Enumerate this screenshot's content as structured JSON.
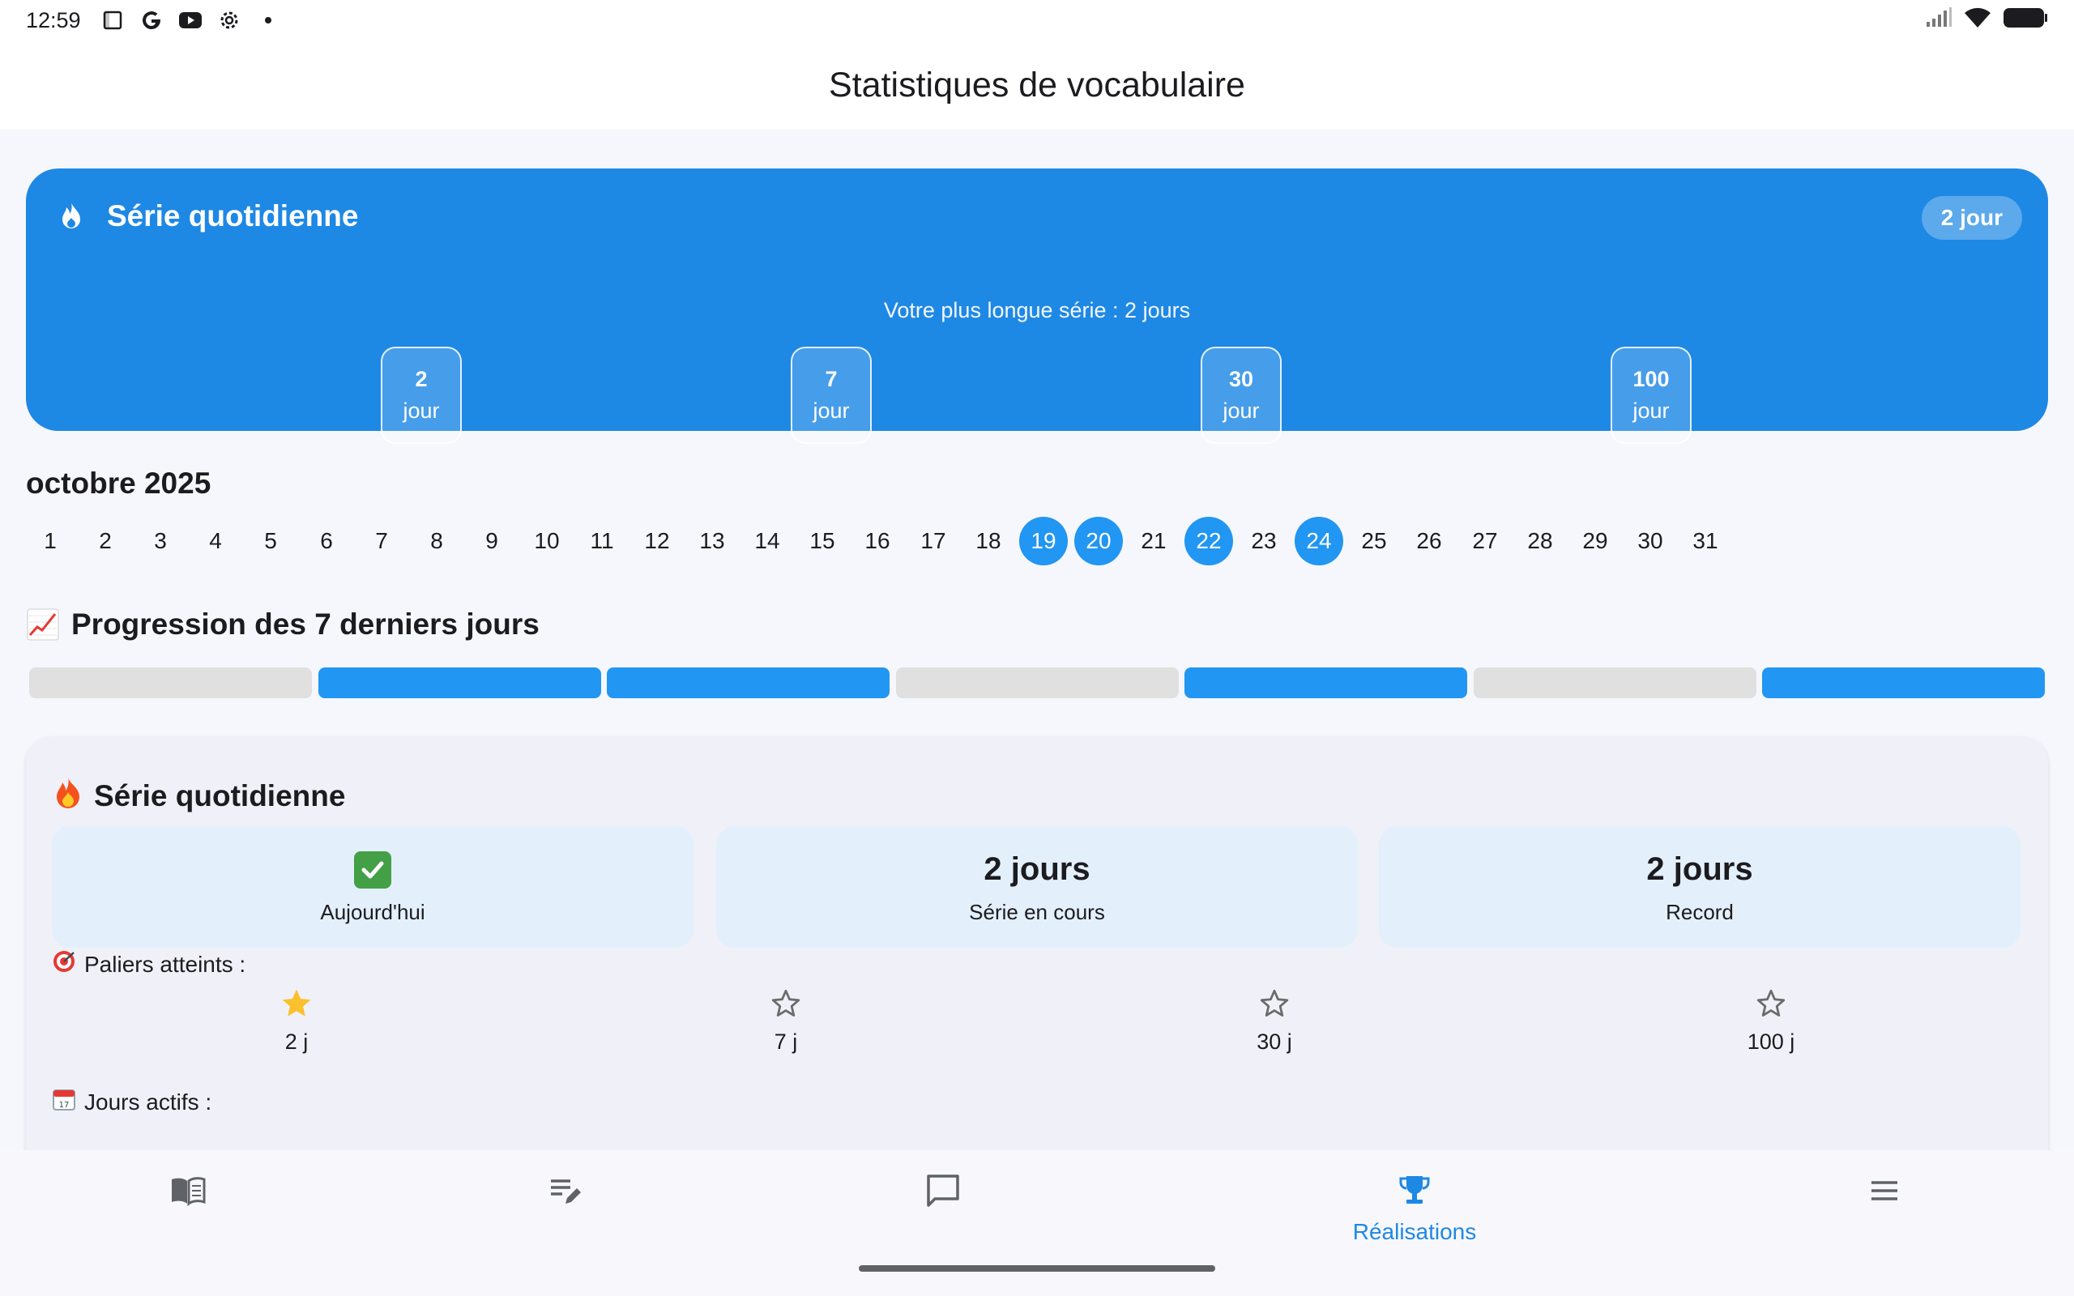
{
  "status_bar": {
    "time": "12:59"
  },
  "app_bar": {
    "title": "Statistiques de vocabulaire"
  },
  "streak_banner": {
    "title": "Série quotidienne",
    "badge": "2 jour",
    "longest": "Votre plus longue série : 2 jours",
    "milestones": [
      {
        "value": "2",
        "unit": "jour"
      },
      {
        "value": "7",
        "unit": "jour"
      },
      {
        "value": "30",
        "unit": "jour"
      },
      {
        "value": "100",
        "unit": "jour"
      }
    ]
  },
  "calendar": {
    "month": "octobre 2025",
    "days": [
      "1",
      "2",
      "3",
      "4",
      "5",
      "6",
      "7",
      "8",
      "9",
      "10",
      "11",
      "12",
      "13",
      "14",
      "15",
      "16",
      "17",
      "18",
      "19",
      "20",
      "21",
      "22",
      "23",
      "24",
      "25",
      "26",
      "27",
      "28",
      "29",
      "30",
      "31"
    ],
    "active_days": [
      "19",
      "20",
      "22",
      "24"
    ]
  },
  "progress": {
    "title": "Progression des 7 derniers jours",
    "days_done": [
      false,
      true,
      true,
      false,
      true,
      false,
      true
    ]
  },
  "streak_card": {
    "title": "Série quotidienne",
    "stats": [
      {
        "value": "",
        "label": "Aujourd'hui"
      },
      {
        "value": "2 jours",
        "label": "Série en cours"
      },
      {
        "value": "2 jours",
        "label": "Record"
      }
    ],
    "paliers_title": "Paliers atteints :",
    "paliers": [
      {
        "label": "2 j",
        "reached": true
      },
      {
        "label": "7 j",
        "reached": false
      },
      {
        "label": "30 j",
        "reached": false
      },
      {
        "label": "100 j",
        "reached": false
      }
    ],
    "jours_actifs_title": "Jours actifs :"
  },
  "bottom_nav": {
    "items": [
      {
        "icon": "book-icon",
        "label": ""
      },
      {
        "icon": "edit-list-icon",
        "label": ""
      },
      {
        "icon": "chat-icon",
        "label": ""
      },
      {
        "icon": "trophy-icon",
        "label": "Réalisations"
      },
      {
        "icon": "menu-icon",
        "label": ""
      }
    ],
    "active_index": 3
  },
  "colors": {
    "primary": "#1e88e5",
    "active_day": "#2196f3",
    "inactive_bar": "#e0e0e0",
    "star": "#fbc02d"
  }
}
